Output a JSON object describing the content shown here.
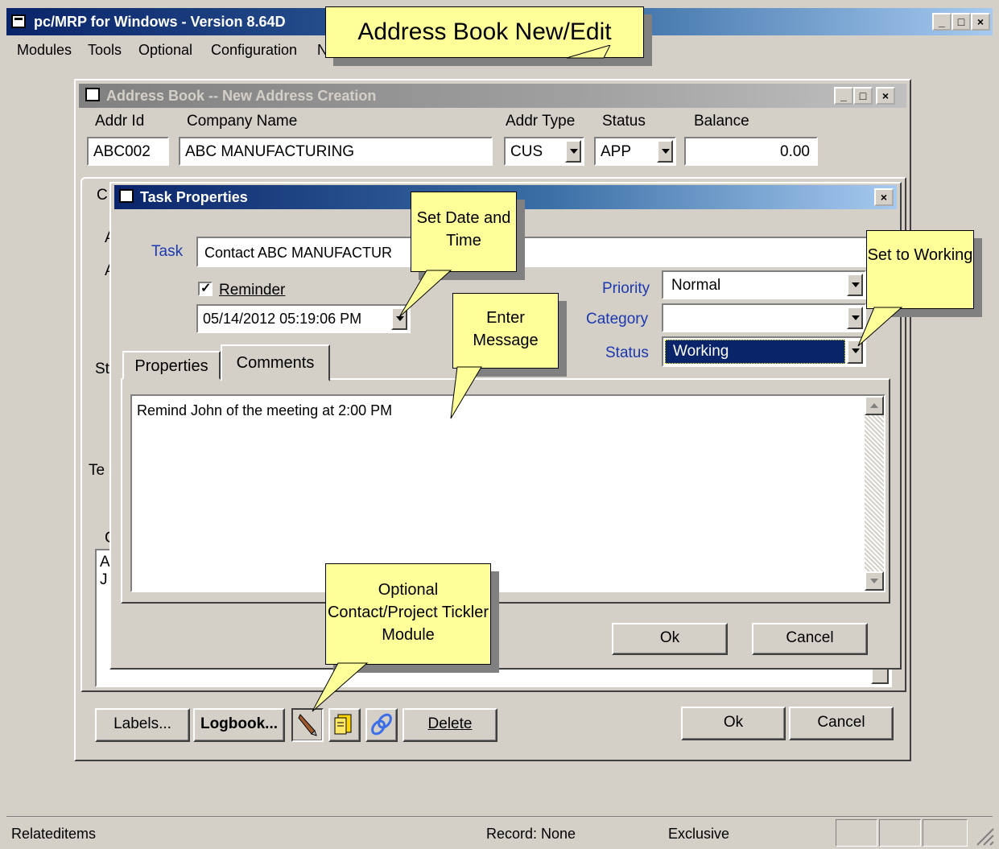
{
  "app": {
    "title": "pc/MRP for Windows - Version 8.64D",
    "menu": [
      "Modules",
      "Tools",
      "Optional",
      "Configuration",
      "N"
    ]
  },
  "callouts": {
    "header": "Address Book New/Edit",
    "set_date": "Set Date and Time",
    "enter_message": "Enter Message",
    "set_working": "Set to Working",
    "optional_module": "Optional Contact/Project Tickler Module"
  },
  "address_book": {
    "title": "Address Book -- New Address Creation",
    "headers": {
      "addr_id": "Addr Id",
      "company": "Company Name",
      "addr_type": "Addr Type",
      "status": "Status",
      "balance": "Balance"
    },
    "values": {
      "addr_id": "ABC002",
      "company": "ABC MANUFACTURING",
      "addr_type": "CUS",
      "status": "APP",
      "balance": "0.00"
    },
    "partial_labels": [
      "C",
      "A",
      "A",
      "St",
      "Te",
      "C",
      "A",
      "J"
    ],
    "buttons": {
      "labels": "Labels...",
      "logbook": "Logbook...",
      "delete": "Delete",
      "ok": "Ok",
      "cancel": "Cancel"
    }
  },
  "task": {
    "title": "Task Properties",
    "task_label": "Task",
    "task_value": "Contact ABC MANUFACTUR",
    "reminder_label": "Reminder",
    "reminder_checked": true,
    "reminder_datetime": "05/14/2012 05:19:06 PM",
    "priority_label": "Priority",
    "priority_value": "Normal",
    "category_label": "Category",
    "category_value": "",
    "status_label": "Status",
    "status_value": "Working",
    "tabs": [
      "Properties",
      "Comments"
    ],
    "active_tab": "Comments",
    "comment": "Remind John of the meeting at 2:00 PM",
    "ok": "Ok",
    "cancel": "Cancel"
  },
  "statusbar": {
    "left": "Relateditems",
    "record": "Record: None",
    "mode": "Exclusive"
  },
  "colors": {
    "active_title": "#0a246a",
    "callout": "#ffff99",
    "label_blue": "#1c38b0",
    "selected": "#0a246a"
  }
}
